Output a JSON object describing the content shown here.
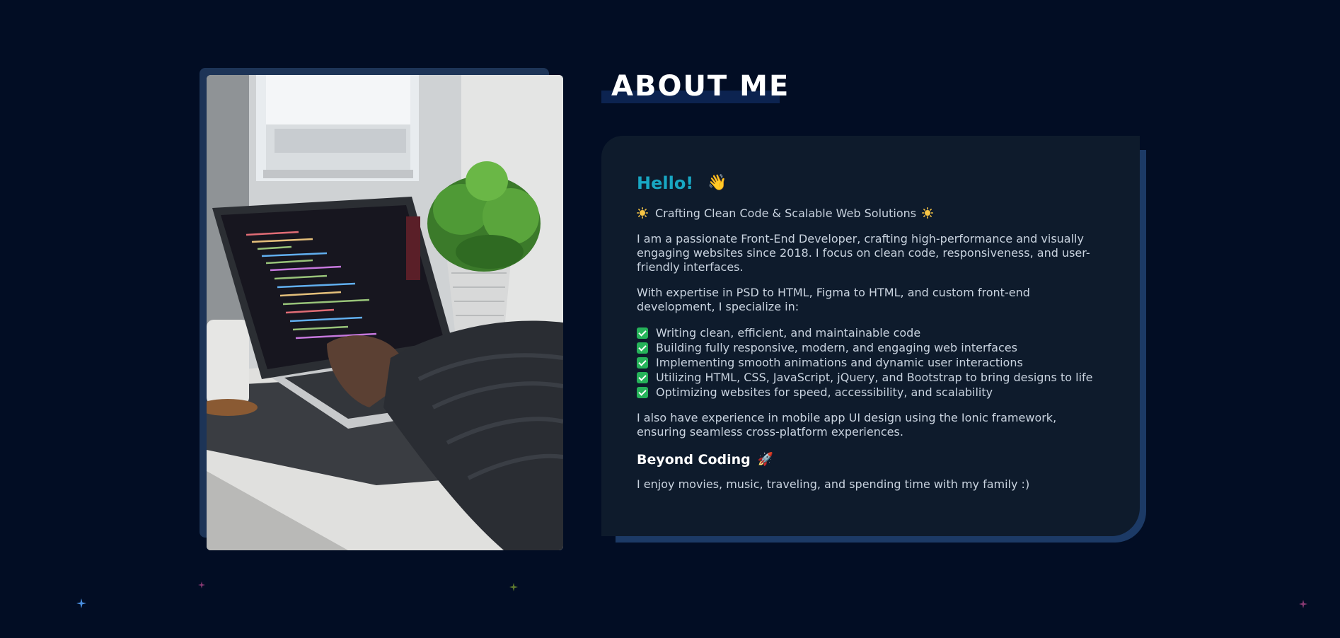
{
  "section": {
    "heading": "ABOUT ME"
  },
  "photo": {
    "description_icon": "photo-laptop-coding"
  },
  "card": {
    "greeting": "Hello!",
    "greeting_emoji": "👋",
    "tagline": "Crafting Clean Code & Scalable Web Solutions",
    "intro": "I am a passionate Front-End Developer, crafting high-performance and visually engaging websites since 2018. I focus on clean code, responsiveness, and user-friendly interfaces.",
    "expertise": "With expertise in PSD to HTML, Figma to HTML, and custom front-end development, I specialize in:",
    "skills": [
      "Writing clean, efficient, and maintainable code",
      "Building fully responsive, modern, and engaging web interfaces",
      "Implementing smooth animations and dynamic user interactions",
      "Utilizing HTML, CSS, JavaScript, jQuery, and Bootstrap to bring designs to life",
      "Optimizing websites for speed, accessibility, and scalability"
    ],
    "mobile": "I also have experience in mobile app UI design using the Ionic framework, ensuring seamless cross-platform experiences.",
    "beyond_title": "Beyond Coding",
    "beyond_emoji": "🚀",
    "hobbies": "I enjoy movies, music, traveling, and spending time with my family :)"
  },
  "colors": {
    "background": "#020d24",
    "accent": "#18a7c3",
    "card": "#0e1b2c",
    "card_shadow": "#1c3a66",
    "check": "#26b35a"
  }
}
